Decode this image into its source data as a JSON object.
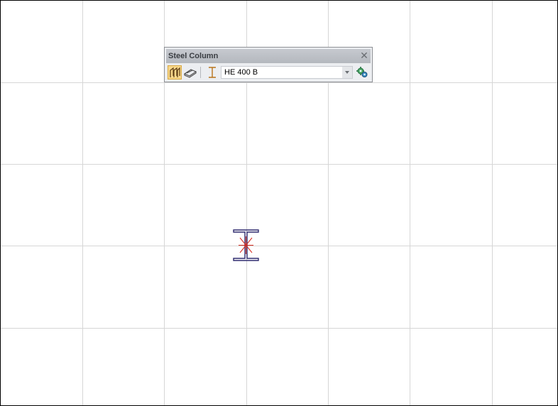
{
  "toolbar": {
    "title": "Steel Column",
    "close_glyph": "✕",
    "tools": [
      {
        "icon": "column-frames-icon",
        "active": true
      },
      {
        "icon": "slab-placement-icon",
        "active": false
      },
      {
        "icon": "i-beam-profile-icon",
        "active": false
      }
    ],
    "profile": {
      "selected": "HE 400 B"
    },
    "settings_icon": "gears-settings-icon"
  },
  "colors": {
    "grid_line": "#d6d6d6",
    "column_outline": "#2e2a6e",
    "column_center_mark": "#d42a1e",
    "active_tool_bg": "#f7d78a"
  },
  "canvas": {
    "symbol": "steel-column-i-section"
  }
}
